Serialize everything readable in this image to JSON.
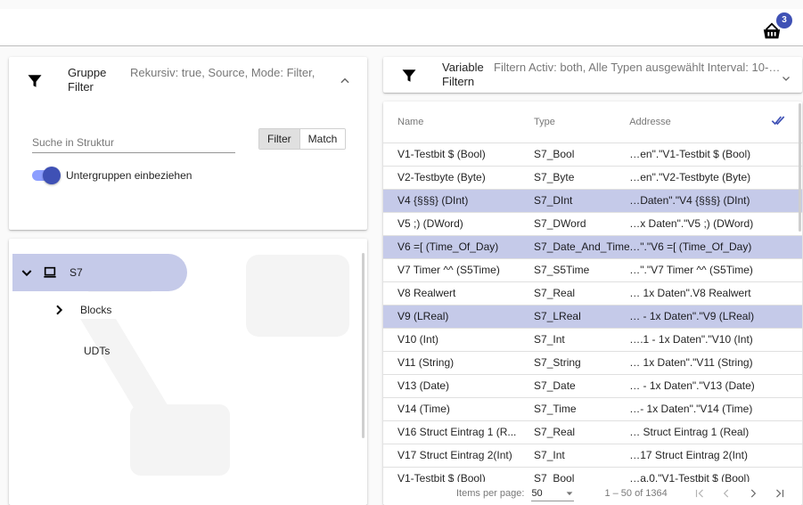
{
  "header": {
    "cart_icon": "basket-icon",
    "cart_badge": "3",
    "accent": "#3f51b5"
  },
  "group_panel": {
    "title": "Gruppe Filter",
    "description": "Rekursiv: true, Source, Mode: Filter,",
    "search_placeholder": "Suche in Struktur",
    "search_value": "",
    "toggle_filter": "Filter",
    "toggle_match": "Match",
    "active_toggle": "Filter",
    "switch_label": "Untergruppen einbeziehen",
    "switch_on": true
  },
  "tree": {
    "root_label": "S7",
    "children": [
      {
        "label": "Blocks",
        "expandable": true
      },
      {
        "label": "UDTs",
        "expandable": false
      }
    ]
  },
  "variable_panel": {
    "title": "Variable Filtern",
    "description": "Filtern Activ: both, Alle Typen ausgewählt Interval: 10-6..."
  },
  "table": {
    "columns": [
      "Name",
      "Type",
      "Addresse"
    ],
    "rows": [
      {
        "name": "V1-Testbit $ (Bool)",
        "type": "S7_Bool",
        "address": "…en\".\"V1-Testbit $ (Bool)",
        "selected": false
      },
      {
        "name": "V2-Testbyte (Byte)",
        "type": "S7_Byte",
        "address": "…en\".\"V2-Testbyte (Byte)",
        "selected": false
      },
      {
        "name": "V4 {§§§} (DInt)",
        "type": "S7_DInt",
        "address": "…Daten\".\"V4 {§§§} (DInt)",
        "selected": true
      },
      {
        "name": "V5 ;) (DWord)",
        "type": "S7_DWord",
        "address": "…x Daten\".\"V5 ;) (DWord)",
        "selected": false
      },
      {
        "name": "V6 =[ (Time_Of_Day)",
        "type": "S7_Date_And_Time",
        "address": "…\".\"V6 =[ (Time_Of_Day)",
        "selected": true
      },
      {
        "name": "V7 Timer ^^ (S5Time)",
        "type": "S7_S5Time",
        "address": "…\".\"V7 Timer ^^ (S5Time)",
        "selected": false
      },
      {
        "name": "V8 Realwert",
        "type": "S7_Real",
        "address": "… 1x Daten\".V8 Realwert",
        "selected": false
      },
      {
        "name": "V9 (LReal)",
        "type": "S7_LReal",
        "address": "… - 1x Daten\".\"V9 (LReal)",
        "selected": true
      },
      {
        "name": "V10 (Int)",
        "type": "S7_Int",
        "address": "….1 - 1x Daten\".\"V10 (Int)",
        "selected": false
      },
      {
        "name": "V11 (String)",
        "type": "S7_String",
        "address": "… 1x Daten\".\"V11 (String)",
        "selected": false
      },
      {
        "name": "V13 (Date)",
        "type": "S7_Date",
        "address": "… - 1x Daten\".\"V13 (Date)",
        "selected": false
      },
      {
        "name": "V14 (Time)",
        "type": "S7_Time",
        "address": "…- 1x Daten\".\"V14 (Time)",
        "selected": false
      },
      {
        "name": "V16 Struct Eintrag 1 (R...",
        "type": "S7_Real",
        "address": "… Struct Eintrag 1 (Real)",
        "selected": false
      },
      {
        "name": "V17 Struct Eintrag 2(Int)",
        "type": "S7_Int",
        "address": "…17 Struct Eintrag 2(Int)",
        "selected": false
      },
      {
        "name": "V1-Testbit $ (Bool)",
        "type": "S7_Bool",
        "address": "…a.0.\"V1-Testbit $ (Bool)",
        "selected": false
      }
    ]
  },
  "paginator": {
    "items_per_page_label": "Items per page:",
    "items_per_page": "50",
    "range": "1 – 50 of 1364"
  }
}
